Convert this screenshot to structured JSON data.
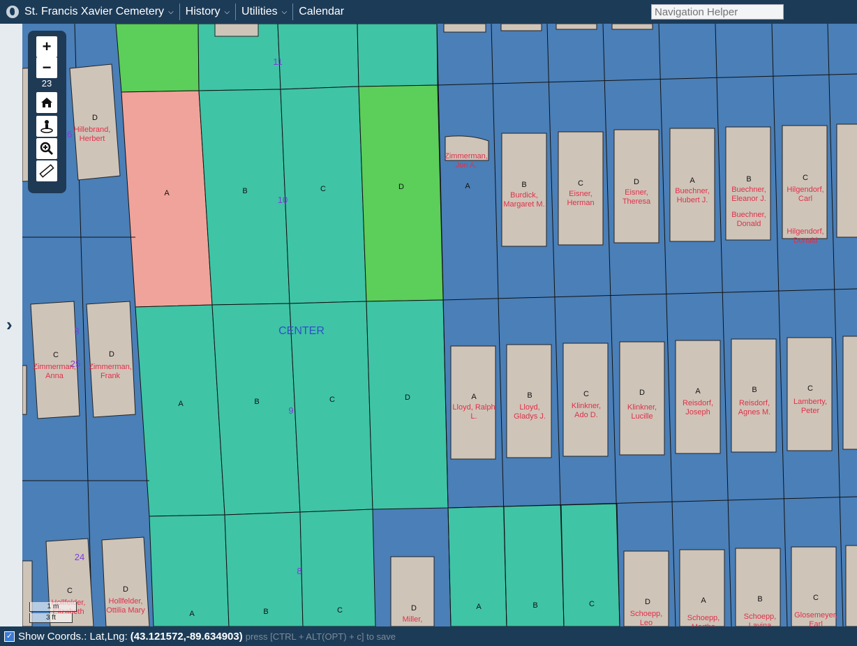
{
  "header": {
    "app_title": "St. Francis Xavier Cemetery",
    "menus": [
      "History",
      "Utilities",
      "Calendar"
    ],
    "nav_placeholder": "Navigation Helper"
  },
  "toolbar": {
    "zoom_in": "+",
    "zoom_out": "−",
    "zoom_level": "23"
  },
  "scale": {
    "metric": "1 m",
    "imperial": "3 ft"
  },
  "footer": {
    "show_coords_label": "Show Coords.: Lat,Lng:",
    "coords": "(43.121572,-89.634903)",
    "hint": "press [CTRL + ALT(OPT) + c] to save"
  },
  "map": {
    "center_label": "CENTER",
    "section_numbers": [
      "11",
      "10",
      "9",
      "8",
      "26",
      "25",
      "24",
      "3"
    ],
    "plot_letters": [
      "A",
      "B",
      "C",
      "D"
    ],
    "names": [
      "Hillebrand, Herbert",
      "Zimmerman, Jon A.",
      "Burdick, Margaret M.",
      "Eisner, Herman",
      "Eisner, Theresa",
      "Buechner, Hubert J.",
      "Buechner, Eleanor J.",
      "Buechner, Donald",
      "Hilgendorf, Carl",
      "Hilgendorf, Donald",
      "Zimmerman, Anna",
      "Zimmerman, Frank",
      "Lloyd, Ralph L.",
      "Lloyd, Gladys J.",
      "Klinkner, Ado D.",
      "Klinkner, Lucille",
      "Reisdorf, Joseph",
      "Reisdorf, Agnes M.",
      "Lamberty, Peter",
      "Hollfelder, Ottilia Mary",
      "Hollfelder, Elizabeth",
      "Miller,",
      "Schoepp, Leo",
      "Schoepp, Martha",
      "Schoepp, Lavina",
      "Glosemeyer, Earl"
    ],
    "colors": {
      "aerial": "#4a7fb8",
      "available": "#3fc4a6",
      "reserved": "#5cce5a",
      "sold": "#f0a39a",
      "headstone": "#cfc4b8",
      "name_text": "#e0304a"
    }
  }
}
